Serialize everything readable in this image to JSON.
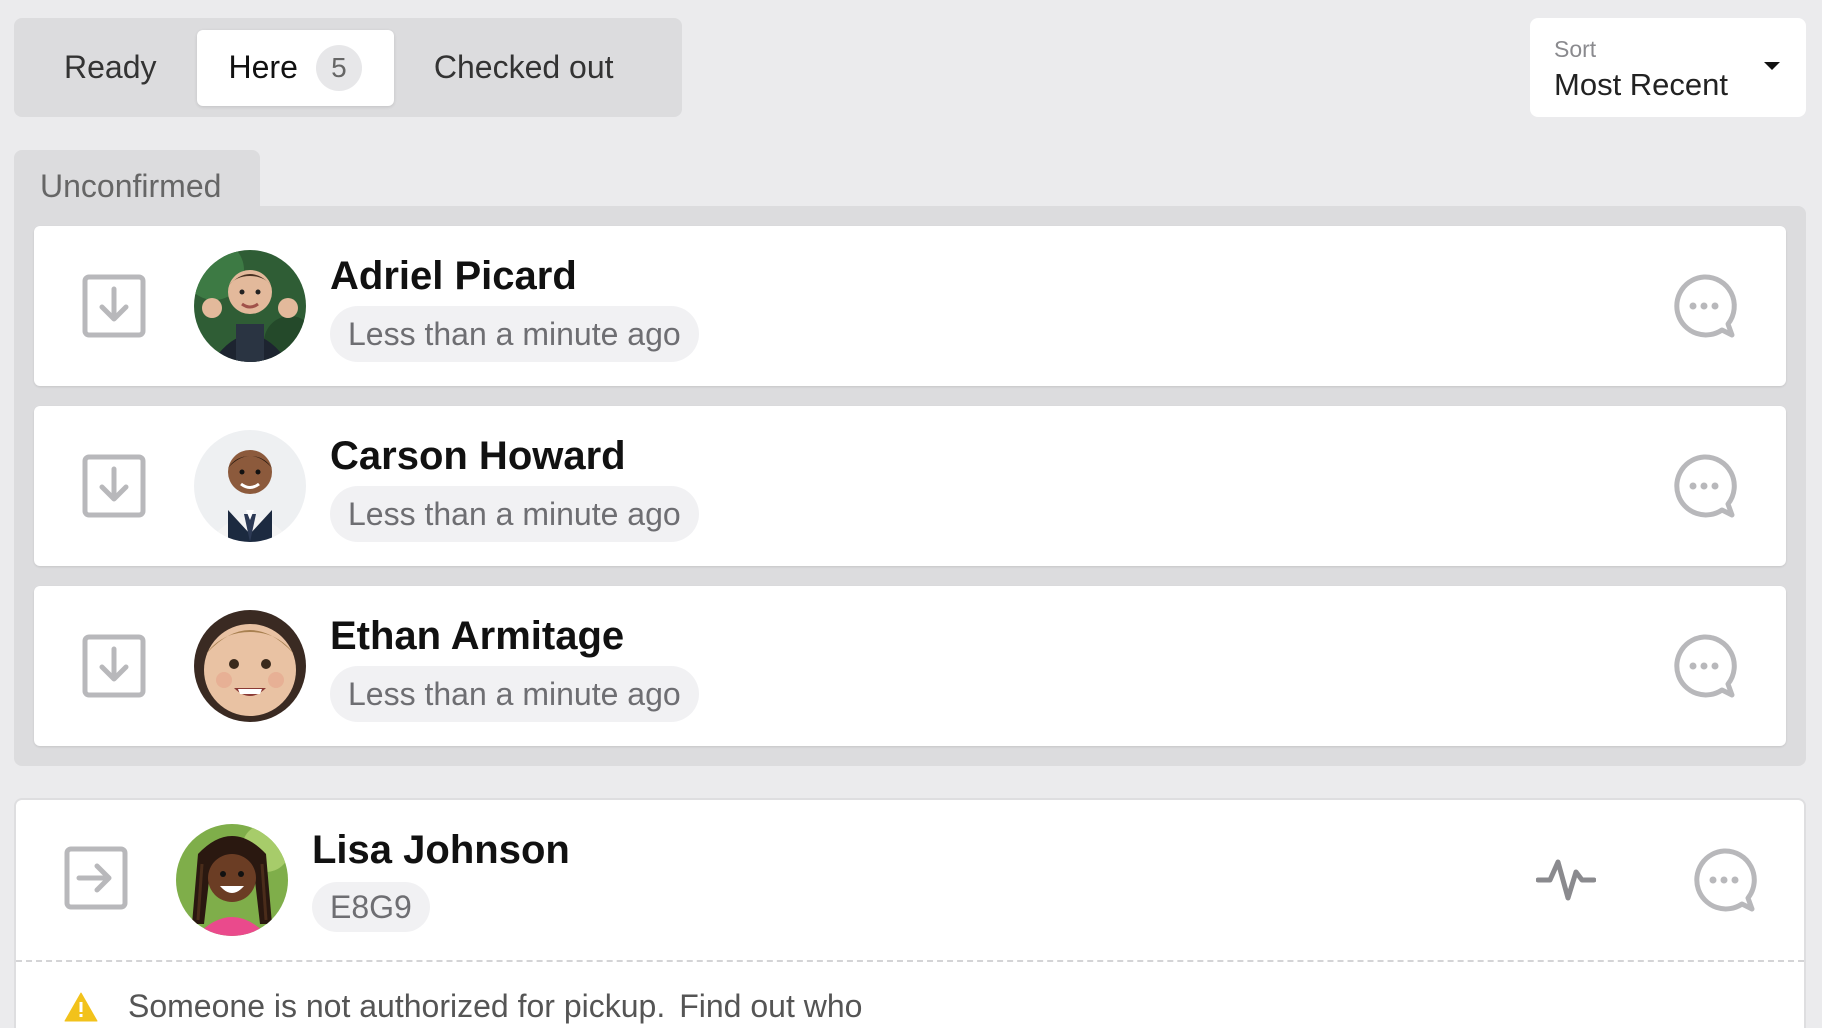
{
  "tabs": [
    {
      "label": "Ready"
    },
    {
      "label": "Here",
      "count": "5"
    },
    {
      "label": "Checked out"
    }
  ],
  "sort": {
    "label": "Sort",
    "value": "Most Recent"
  },
  "group": {
    "title": "Unconfirmed",
    "items": [
      {
        "name": "Adriel Picard",
        "time": "Less than a minute ago"
      },
      {
        "name": "Carson Howard",
        "time": "Less than a minute ago"
      },
      {
        "name": "Ethan Armitage",
        "time": "Less than a minute ago"
      }
    ]
  },
  "checked_in": {
    "name": "Lisa Johnson",
    "code": "E8G9",
    "warning_text": "Someone is not authorized for pickup.",
    "warning_link": "Find out who"
  },
  "colors": {
    "background": "#ebebed",
    "panel": "#dcdcde",
    "card": "#ffffff",
    "icon_gray": "#b8b8bb",
    "warning_yellow": "#f2c21b"
  },
  "icons": {
    "confirm": "download-arrow-icon",
    "checkin": "arrow-right-box-icon",
    "message": "chat-bubble-dots-icon",
    "activity": "pulse-icon",
    "warning": "warning-triangle-icon"
  }
}
